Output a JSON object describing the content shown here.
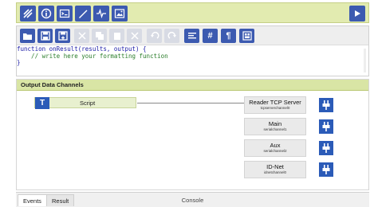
{
  "top_toolbar": {
    "buttons": [
      "signal-icon",
      "info-icon",
      "terminal-icon",
      "pen-icon",
      "waveform-icon",
      "image-icon"
    ],
    "run": "play-icon"
  },
  "editor": {
    "toolbar_buttons": [
      {
        "icon": "open-folder-icon",
        "enabled": true
      },
      {
        "icon": "save-icon",
        "enabled": true
      },
      {
        "icon": "save-as-icon",
        "enabled": true
      },
      {
        "icon": "cut-icon",
        "enabled": false
      },
      {
        "icon": "copy-icon",
        "enabled": false
      },
      {
        "icon": "paste-icon",
        "enabled": false
      },
      {
        "icon": "delete-icon",
        "enabled": false
      },
      {
        "icon": "undo-icon",
        "enabled": false
      },
      {
        "icon": "redo-icon",
        "enabled": false
      },
      {
        "icon": "format-code-icon",
        "enabled": true,
        "text": ""
      },
      {
        "icon": "line-numbers-icon",
        "enabled": true,
        "text": "#"
      },
      {
        "icon": "paragraph-icon",
        "enabled": true,
        "text": "¶"
      },
      {
        "icon": "settings-panel-icon",
        "enabled": true
      }
    ],
    "code_line1": "function onResult(results, output) {",
    "code_line2": "    // write here your formatting function",
    "code_line3": "}"
  },
  "channels": {
    "header": "Output Data Channels",
    "script_label": "Script",
    "script_icon_letter": "T",
    "items": [
      {
        "name": "Reader TCP Server",
        "id": "tcpserverchannel0"
      },
      {
        "name": "Main",
        "id": "serialchannel1"
      },
      {
        "name": "Aux",
        "id": "serialchannel2"
      },
      {
        "name": "ID-Net",
        "id": "idnetchannel0"
      }
    ]
  },
  "bottom_tabs": {
    "events": "Events",
    "result": "Result",
    "console": "Console"
  },
  "colors": {
    "accent_blue": "#3c5ab0",
    "header_green": "#d9e5a5",
    "toolbar_green": "#e2ebb0"
  }
}
